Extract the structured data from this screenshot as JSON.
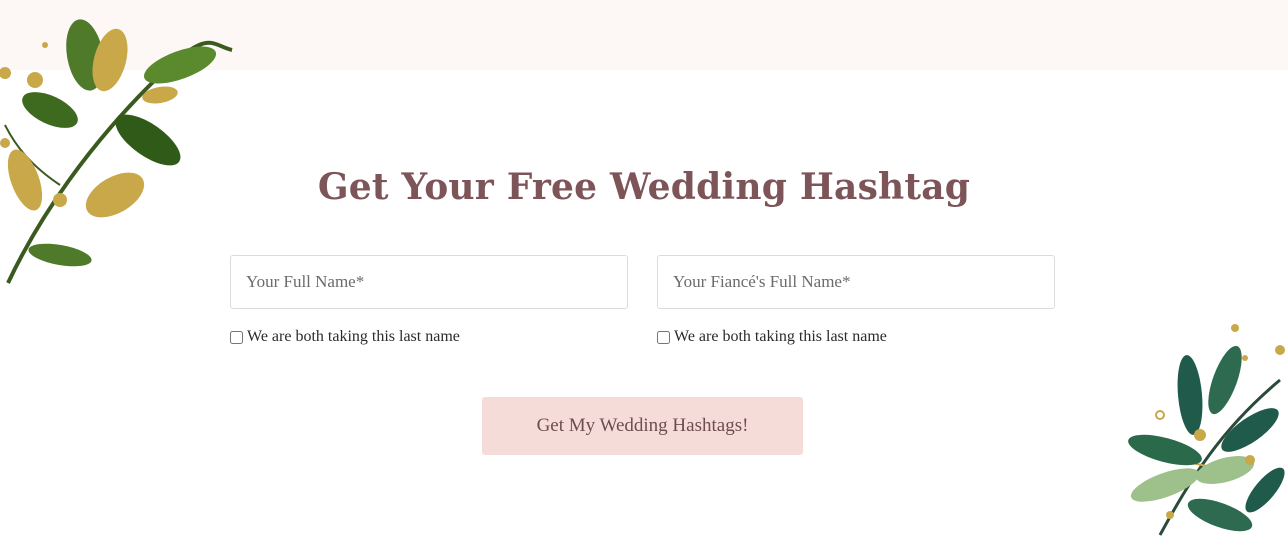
{
  "form": {
    "title": "Get Your Free Wedding Hashtag",
    "name_placeholder": "Your Full Name*",
    "fiance_placeholder": "Your Fiancé's Full Name*",
    "checkbox_label_left": "We are both taking this last name",
    "checkbox_label_right": "We are both taking this last name",
    "submit_label": "Get My Wedding Hashtags!"
  },
  "colors": {
    "title": "#7d5558",
    "button_bg": "#f6dcd9",
    "top_band": "#fdf7f6",
    "leaf_green": "#4e7a2a",
    "leaf_dark": "#1f5a4a",
    "gold": "#c9a84a"
  },
  "icons": {
    "top_left": "botanical-leaves-icon",
    "bottom_right": "botanical-leaves-icon"
  }
}
